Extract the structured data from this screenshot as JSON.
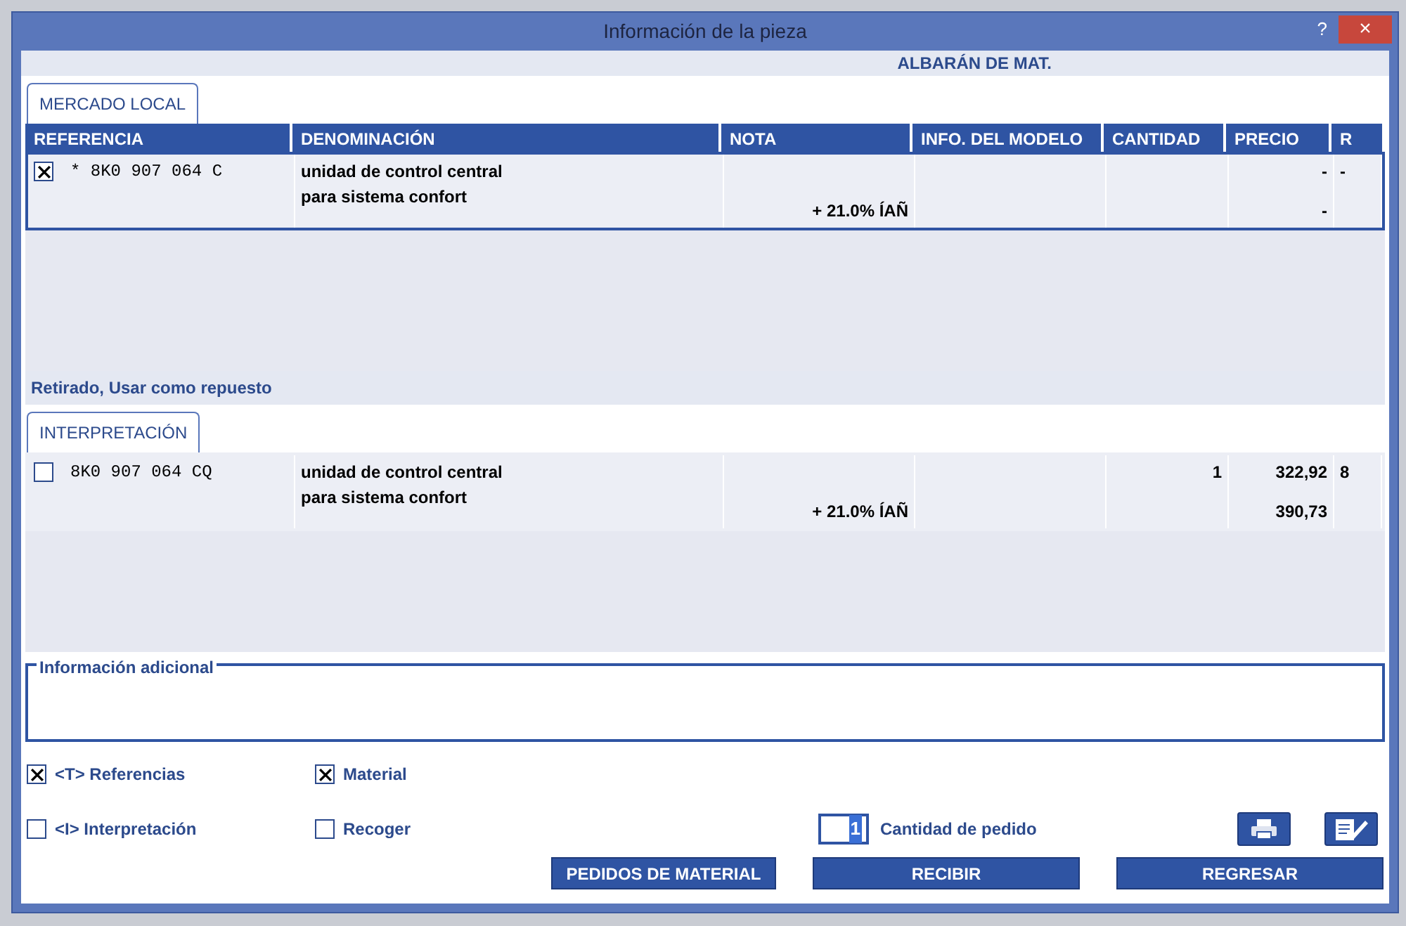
{
  "window": {
    "title": "Información de la pieza",
    "help": "?",
    "close": "×"
  },
  "header": "ALBARÁN DE MAT.",
  "sections": [
    {
      "tab": "MERCADO LOCAL",
      "selected": true,
      "columns": [
        "REFERENCIA",
        "DENOMINACIÓN",
        "NOTA",
        "INFO. DEL MODELO",
        "CANTIDAD",
        "PRECIO",
        "R"
      ],
      "rows": [
        {
          "checked": true,
          "selected": true,
          "reference": "* 8K0 907 064 C",
          "denomination": "unidad de control central para sistema confort",
          "note": "+ 21.0% ÍAÑ",
          "price": "-",
          "price_total": "-",
          "r": "-"
        }
      ]
    },
    {
      "status": "Retirado, Usar como repuesto",
      "tab": "INTERPRETACIÓN",
      "selected": true,
      "rows": [
        {
          "checked": false,
          "selected": false,
          "reference": "8K0 907 064 CQ",
          "denomination": "unidad de control central para sistema confort",
          "note": "+ 21.0% ÍAÑ",
          "quantity": "1",
          "price": "322,92",
          "price_total": "390,73",
          "r": "8"
        }
      ]
    }
  ],
  "info_box": {
    "legend": "Información adicional"
  },
  "options": [
    {
      "label": "<T> Referencias",
      "checked": true
    },
    {
      "label": "Material",
      "checked": true
    },
    {
      "label": "<I> Interpretación",
      "checked": false
    },
    {
      "label": "Recoger",
      "checked": false
    }
  ],
  "quantity": {
    "value": "1",
    "label": "Cantidad de pedido"
  },
  "buttons": [
    "PEDIDOS DE MATERIAL",
    "RECIBIR",
    "REGRESAR"
  ]
}
